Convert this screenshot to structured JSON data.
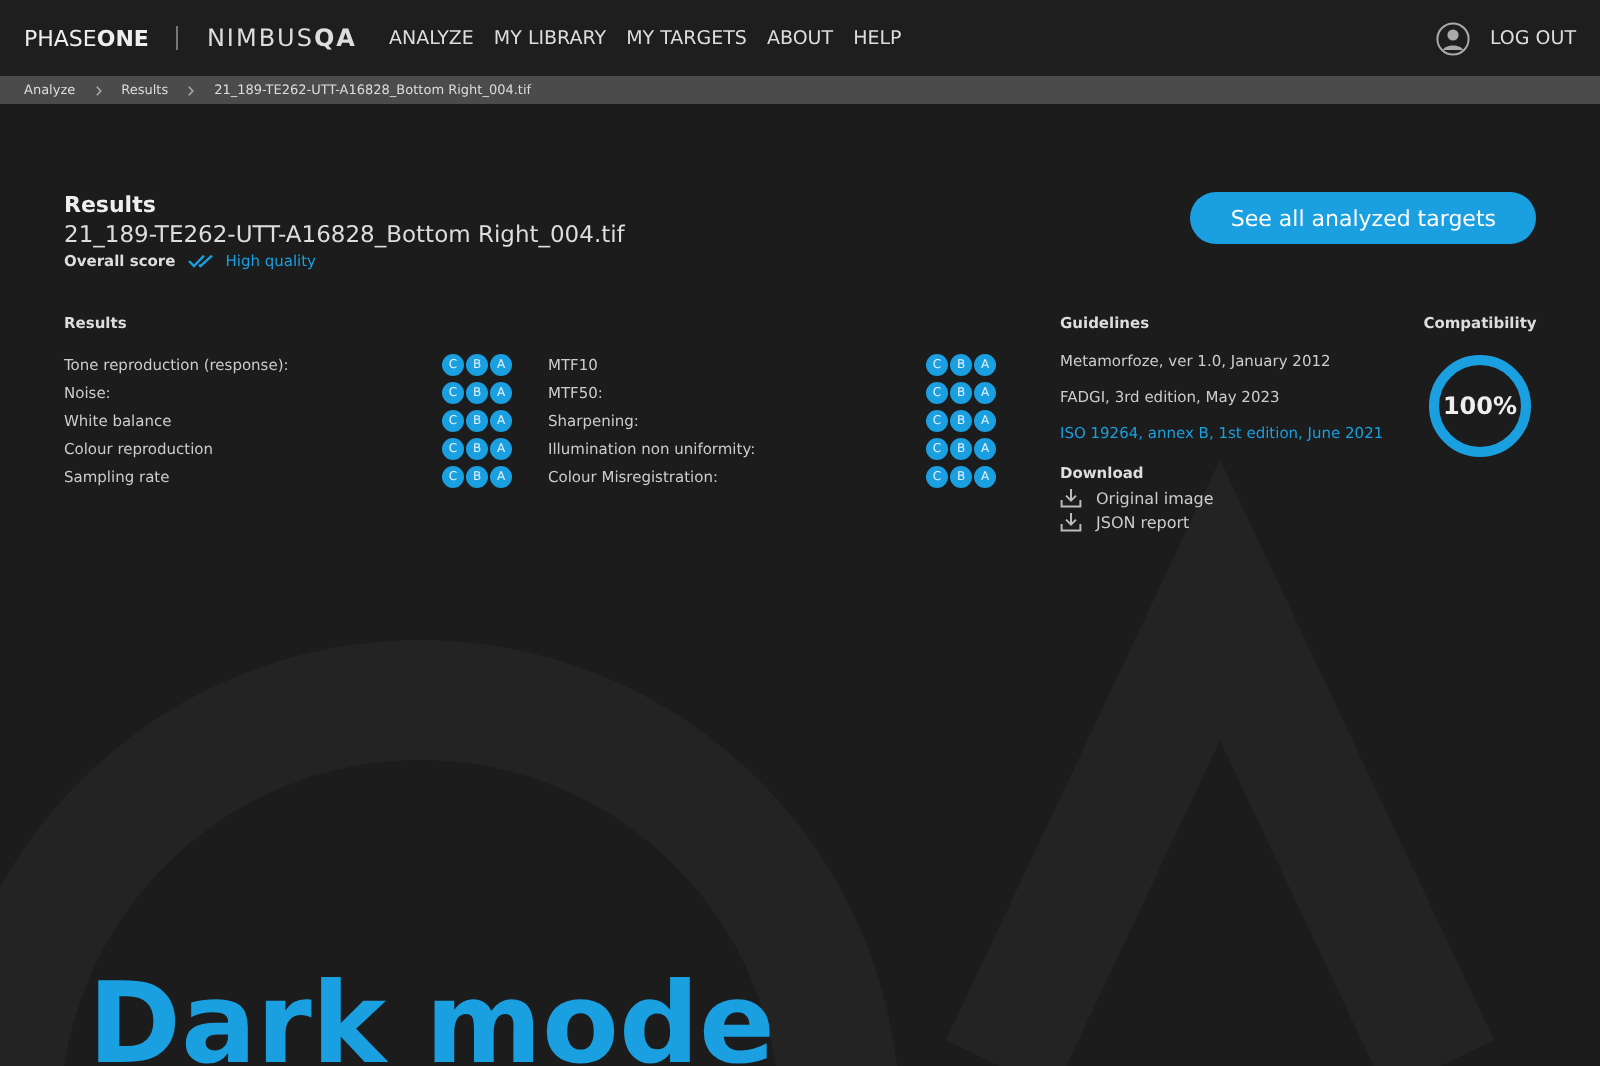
{
  "header": {
    "brand": "PHASE**ONE**",
    "product": "NIMBUS**QA**",
    "nav": [
      {
        "label": "ANALYZE",
        "selected": false
      },
      {
        "label": "MY LIBRARY",
        "selected": false
      },
      {
        "label": "MY TARGETS",
        "selected": false
      },
      {
        "label": "ABOUT",
        "selected": false
      },
      {
        "label": "HELP",
        "selected": false
      }
    ],
    "logout": "LOG OUT"
  },
  "breadcrumb": [
    "Analyze",
    "Results",
    "21_189-TE262-UTT-A16828_Bottom Right_004.tif"
  ],
  "title": "Results",
  "file": "21_189-TE262-UTT-A16828_Bottom Right_004.tif",
  "score_label": "Overall score",
  "score": "High quality",
  "action": "See all analyzed targets",
  "results": {
    "heading": "Results",
    "columns": [
      [
        {
          "name": "Tone reproduction (response):",
          "grades": [
            {
              "label": "C",
              "selected": true
            },
            {
              "label": "B",
              "selected": true
            },
            {
              "label": "A",
              "selected": true
            }
          ]
        },
        {
          "name": "Noise:",
          "grades": [
            {
              "label": "C",
              "selected": true
            },
            {
              "label": "B",
              "selected": true
            },
            {
              "label": "A",
              "selected": true
            }
          ]
        },
        {
          "name": "White balance",
          "grades": [
            {
              "label": "C",
              "selected": true
            },
            {
              "label": "B",
              "selected": true
            },
            {
              "label": "A",
              "selected": true
            }
          ]
        },
        {
          "name": "Colour reproduction",
          "grades": [
            {
              "label": "C",
              "selected": true
            },
            {
              "label": "B",
              "selected": true
            },
            {
              "label": "A",
              "selected": true
            }
          ]
        },
        {
          "name": "Sampling rate",
          "grades": [
            {
              "label": "C",
              "selected": true
            },
            {
              "label": "B",
              "selected": true
            },
            {
              "label": "A",
              "selected": true
            }
          ]
        }
      ],
      [
        {
          "name": "MTF10",
          "grades": [
            {
              "label": "C",
              "selected": true
            },
            {
              "label": "B",
              "selected": true
            },
            {
              "label": "A",
              "selected": true
            }
          ]
        },
        {
          "name": "MTF50:",
          "grades": [
            {
              "label": "C",
              "selected": true
            },
            {
              "label": "B",
              "selected": true
            },
            {
              "label": "A",
              "selected": true
            }
          ]
        },
        {
          "name": "Sharpening:",
          "grades": [
            {
              "label": "C",
              "selected": true
            },
            {
              "label": "B",
              "selected": true
            },
            {
              "label": "A",
              "selected": true
            }
          ]
        },
        {
          "name": "Illumination non uniformity:",
          "grades": [
            {
              "label": "C",
              "selected": true
            },
            {
              "label": "B",
              "selected": true
            },
            {
              "label": "A",
              "selected": true
            }
          ]
        },
        {
          "name": "Colour Misregistration:",
          "grades": [
            {
              "label": "C",
              "selected": true
            },
            {
              "label": "B",
              "selected": true
            },
            {
              "label": "A",
              "selected": true
            }
          ]
        }
      ]
    ]
  },
  "guidelines": {
    "heading": "Guidelines",
    "items": [
      {
        "label": "Metamorfoze, ver 1.0, January 2012",
        "selected": false
      },
      {
        "label": "FADGI, 3rd edition, May 2023",
        "selected": false
      },
      {
        "label": "ISO 19264, annex B, 1st edition, June 2021",
        "selected": true
      }
    ]
  },
  "compatibility": {
    "heading": "Compatibility",
    "value": "100%",
    "level": 1
  },
  "download": {
    "heading": "Download",
    "items": [
      "Original image",
      "JSON report"
    ]
  },
  "banner": "Dark mode"
}
